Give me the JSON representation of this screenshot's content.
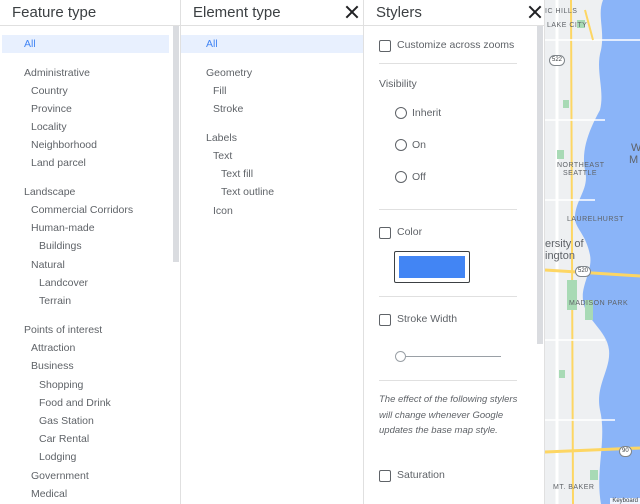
{
  "feature_panel": {
    "title": "Feature type",
    "items": [
      {
        "label": "All",
        "selected": true
      },
      {
        "label": "Administrative"
      },
      {
        "label": "Country"
      },
      {
        "label": "Province"
      },
      {
        "label": "Locality"
      },
      {
        "label": "Neighborhood"
      },
      {
        "label": "Land parcel"
      },
      {
        "label": "Landscape"
      },
      {
        "label": "Commercial Corridors"
      },
      {
        "label": "Human-made"
      },
      {
        "label": "Buildings"
      },
      {
        "label": "Natural"
      },
      {
        "label": "Landcover"
      },
      {
        "label": "Terrain"
      },
      {
        "label": "Points of interest"
      },
      {
        "label": "Attraction"
      },
      {
        "label": "Business"
      },
      {
        "label": "Shopping"
      },
      {
        "label": "Food and Drink"
      },
      {
        "label": "Gas Station"
      },
      {
        "label": "Car Rental"
      },
      {
        "label": "Lodging"
      },
      {
        "label": "Government"
      },
      {
        "label": "Medical"
      }
    ]
  },
  "element_panel": {
    "title": "Element type",
    "items": [
      {
        "label": "All",
        "selected": true
      },
      {
        "label": "Geometry"
      },
      {
        "label": "Fill"
      },
      {
        "label": "Stroke"
      },
      {
        "label": "Labels"
      },
      {
        "label": "Text"
      },
      {
        "label": "Text fill"
      },
      {
        "label": "Text outline"
      },
      {
        "label": "Icon"
      }
    ]
  },
  "styler_panel": {
    "title": "Stylers",
    "customize_label": "Customize across zooms",
    "visibility_heading": "Visibility",
    "visibility_options": [
      "Inherit",
      "On",
      "Off"
    ],
    "color_label": "Color",
    "color_value": "#4285f4",
    "stroke_width_label": "Stroke Width",
    "stroke_width_level": 0,
    "note": "The effect of the following stylers will change whenever Google updates the base map style.",
    "saturation_label": "Saturation"
  },
  "map": {
    "labels": {
      "hills": "IC HILLS",
      "lake_city": "LAKE CITY",
      "northeast": "NORTHEAST",
      "seattle": "SEATTLE",
      "laurelhurst": "LAURELHURST",
      "univ1": "ersity of",
      "univ2": "ington",
      "madison": "MADISON PARK",
      "baker": "MT. BAKER",
      "edge_w": "W",
      "edge_m": "M",
      "keyboard": "Keyboard"
    },
    "shields": [
      "522",
      "520",
      "90"
    ]
  }
}
